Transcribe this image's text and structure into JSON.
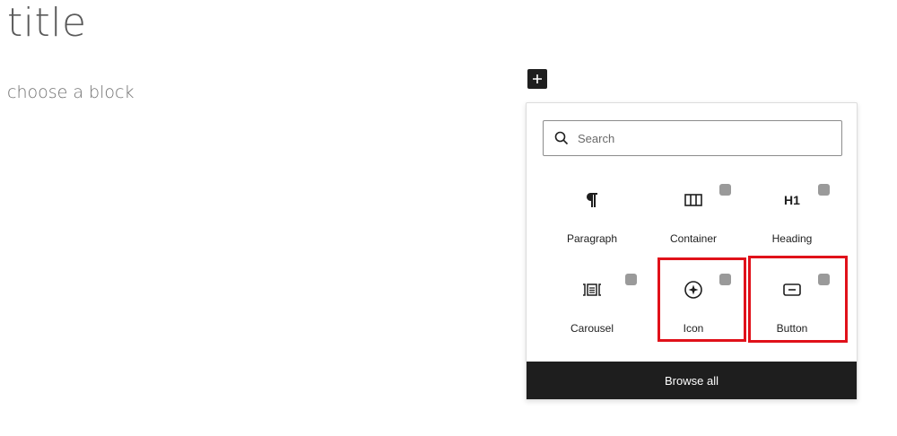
{
  "editor": {
    "title": "title",
    "placeholder": "choose a block"
  },
  "inserter": {
    "search_placeholder": "Search",
    "blocks": [
      {
        "label": "Paragraph",
        "icon": "paragraph-icon",
        "badge": false
      },
      {
        "label": "Container",
        "icon": "columns-icon",
        "badge": true
      },
      {
        "label": "Heading",
        "icon": "heading-icon",
        "icon_text": "H1",
        "badge": true
      },
      {
        "label": "Carousel",
        "icon": "carousel-icon",
        "badge": true
      },
      {
        "label": "Icon",
        "icon": "star-icon",
        "badge": true
      },
      {
        "label": "Button",
        "icon": "button-icon",
        "badge": true
      }
    ],
    "browse_all_label": "Browse all"
  },
  "colors": {
    "highlight": "#e0111a",
    "dark": "#1e1e1e",
    "badge": "#9a9a9a"
  }
}
